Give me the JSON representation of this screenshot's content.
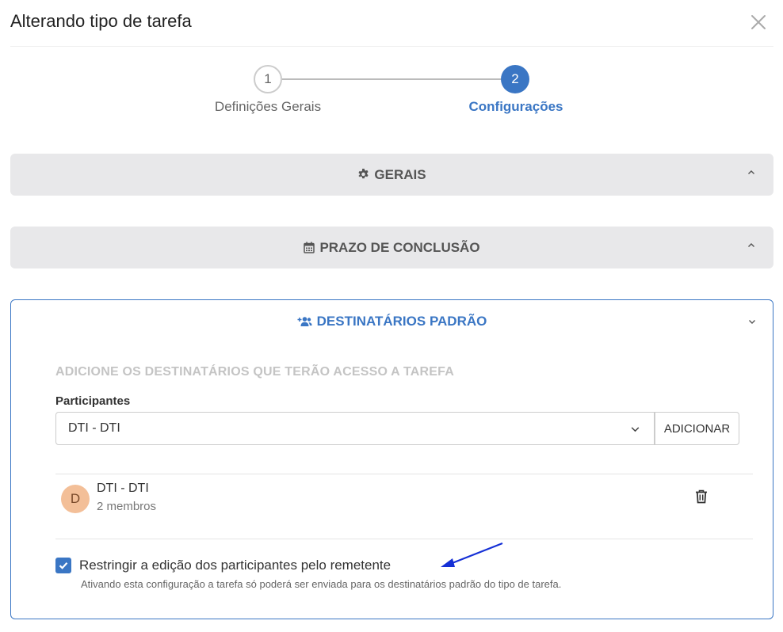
{
  "modal": {
    "title": "Alterando tipo de tarefa"
  },
  "stepper": {
    "steps": [
      {
        "number": "1",
        "label": "Definições Gerais",
        "state": "completed"
      },
      {
        "number": "2",
        "label": "Configurações",
        "state": "active"
      }
    ]
  },
  "panels": {
    "gerais": {
      "label": "GERAIS",
      "icon": "gear-icon"
    },
    "prazo": {
      "label": "PRAZO DE CONCLUSÃO",
      "icon": "calendar-icon"
    },
    "destinatarios": {
      "label": "DESTINATÁRIOS PADRÃO",
      "icon": "users-add-icon",
      "heading": "ADICIONE OS DESTINATÁRIOS QUE TERÃO ACESSO A TAREFA",
      "participants_label": "Participantes",
      "select_value": "DTI - DTI",
      "add_button": "ADICIONAR",
      "members": [
        {
          "initial": "D",
          "name": "DTI - DTI",
          "count": "2 membros"
        }
      ],
      "restrict_checkbox": {
        "checked": true,
        "label": "Restringir a edição dos participantes pelo remetente",
        "help": "Ativando esta configuração a tarefa só poderá ser enviada para os destinatários padrão do tipo de tarefa."
      }
    }
  },
  "colors": {
    "accent": "#3a76c4",
    "panel_bg": "#e8e8ea",
    "avatar_bg": "#f3bf98",
    "annotation_arrow": "#1530d6"
  }
}
